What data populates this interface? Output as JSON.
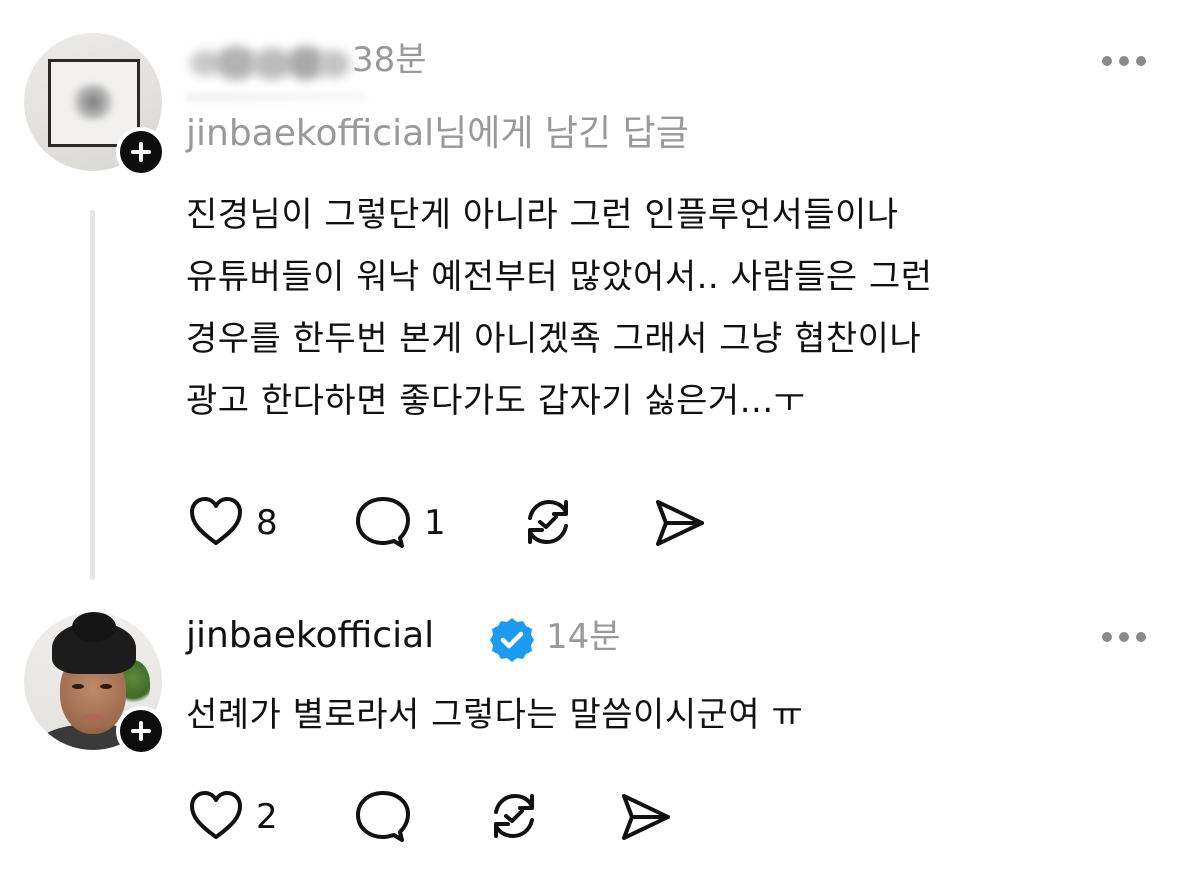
{
  "comments": [
    {
      "username": "",
      "username_redacted": true,
      "time": "38분",
      "reply_to": "jinbaekofficial님에게 남긴 답글",
      "text_lines": [
        "진경님이 그렇단게 아니라 그런 인플루언서들이나",
        "유튜버들이 워낙 예전부터 많았어서.. 사람들은 그런",
        "경우를 한두번 본게 아니겠죡 그래서 그냥 협찬이나",
        "광고 한다하면 좋다가도 갑자기 싫은거...ㅜ"
      ],
      "likes": "8",
      "replies": "1"
    },
    {
      "username": "jinbaekofficial",
      "verified": true,
      "time": "14분",
      "text_lines": [
        "선례가 별로라서 그렇다는 말씀이시군여 ㅠ"
      ],
      "likes": "2",
      "replies": ""
    }
  ],
  "icons": {
    "like": "heart-icon",
    "reply": "comment-bubble-icon",
    "repost": "repost-icon",
    "share": "send-icon",
    "more": "more-icon",
    "follow": "plus-icon",
    "verified": "verified-badge-icon"
  },
  "colors": {
    "text": "#111111",
    "meta": "#999999",
    "verified_badge": "#1d9bf0",
    "thread_line": "#e6e6e6"
  }
}
